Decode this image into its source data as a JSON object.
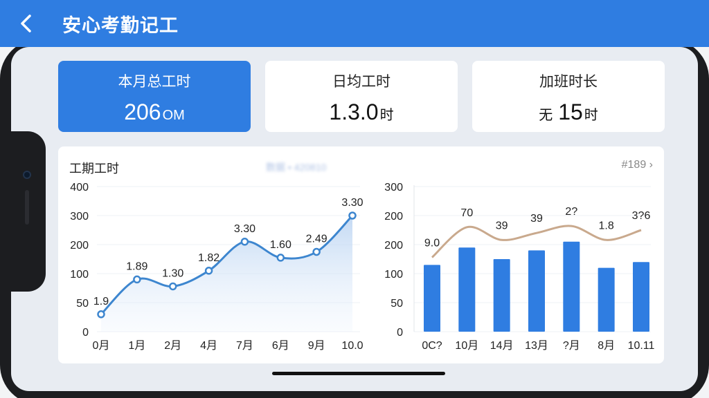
{
  "app_bar": {
    "title": "安心考勤记工"
  },
  "stats": [
    {
      "label": "本月总工时",
      "value": "206",
      "unit": "OM"
    },
    {
      "label": "日均工时",
      "value": "1.3.0",
      "unit": "时"
    },
    {
      "label": "加班时长",
      "prefix": "无",
      "value": "15",
      "unit": "时"
    }
  ],
  "panel": {
    "title": "工期工时",
    "meta": "数据 • 420810",
    "more": "#189"
  },
  "colors": {
    "primary": "#2f7de1",
    "line": "#3d86cf",
    "bar": "#2f7de1",
    "trend": "#c9a98d"
  },
  "chart_data": [
    {
      "type": "area",
      "categories": [
        "0月",
        "1月",
        "2月",
        "4月",
        "7月",
        "6月",
        "9月",
        "10.0"
      ],
      "y_ticks": [
        "400",
        "300",
        "200",
        "100",
        "50",
        "0"
      ],
      "y_tick_values": [
        400,
        300,
        200,
        100,
        50,
        0
      ],
      "values": [
        30,
        90,
        78,
        110,
        210,
        155,
        175,
        300
      ],
      "labels": [
        "1.9",
        "1.89",
        "1.30",
        "1.82",
        "3.30",
        "1.60",
        "2.49",
        "3.30"
      ]
    },
    {
      "type": "bar",
      "categories": [
        "0C?",
        "10月",
        "14月",
        "13月",
        "?月",
        "8月",
        "10.11"
      ],
      "y_ticks": [
        "300",
        "200",
        "200",
        "100",
        "50",
        "0"
      ],
      "y_tick_values": [
        300,
        200,
        200,
        100,
        50,
        0
      ],
      "values": [
        115,
        145,
        125,
        140,
        155,
        110,
        120
      ],
      "line_values": [
        128,
        180,
        158,
        170,
        182,
        158,
        175
      ],
      "labels": [
        "9.0",
        "70",
        "39",
        "39",
        "2?",
        "1.8",
        "3?6"
      ]
    }
  ]
}
